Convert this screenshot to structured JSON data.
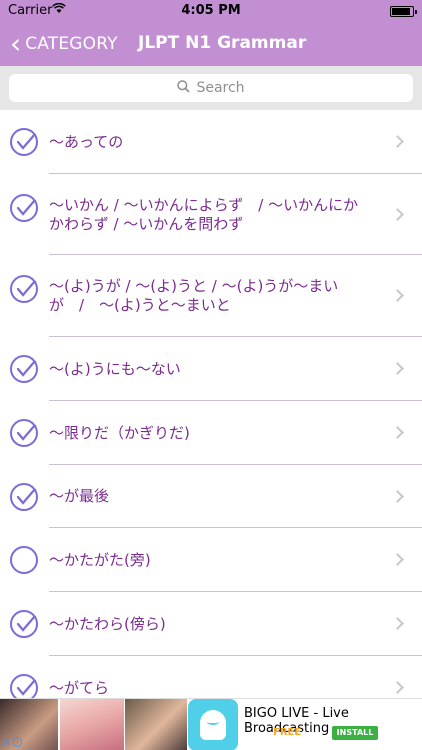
{
  "status_bar": {
    "carrier": "Carrier",
    "time": "4:05 PM",
    "battery_level": 0.9
  },
  "nav": {
    "back_label": "CATEGORY",
    "title": "JLPT N1 Grammar"
  },
  "search": {
    "placeholder": "Search"
  },
  "items": [
    {
      "text": "〜あっての",
      "checked": true
    },
    {
      "text": "〜いかん / 〜いかんによらず　/ 〜いかんにかかわらず / 〜いかんを問わず",
      "checked": true
    },
    {
      "text": "〜(よ)うが / 〜(よ)うと / 〜(よ)うが〜まいが　/　〜(よ)うと〜まいと",
      "checked": true
    },
    {
      "text": "〜(よ)うにも〜ない",
      "checked": true
    },
    {
      "text": "〜限りだ（かぎりだ)",
      "checked": true
    },
    {
      "text": "〜が最後",
      "checked": true
    },
    {
      "text": "〜かたがた(旁)",
      "checked": false
    },
    {
      "text": "〜かたわら(傍ら)",
      "checked": true
    },
    {
      "text": "〜がてら",
      "checked": true
    }
  ],
  "ad": {
    "app_name": "BIGO LIVE - Live Broadcasting",
    "price": "FREE",
    "install_label": "INSTALL"
  },
  "colors": {
    "header": "#c38fd3",
    "item_text": "#7b2c91",
    "check": "#7e6ad6"
  }
}
